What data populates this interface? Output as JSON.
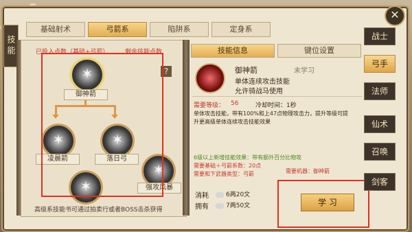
{
  "side_tab": "技能",
  "close_label": "✕",
  "top_tabs": [
    "基础射术",
    "弓箭系",
    "陷阱系",
    "定身系"
  ],
  "points": {
    "invested": "已投入点数（基础+弓箭）",
    "remaining": "剩余技能点数"
  },
  "help_label": "?",
  "tree": {
    "root": {
      "label": "御神箭",
      "glyph": "✶"
    },
    "left": {
      "label": "凌晨箭",
      "glyph": "✶"
    },
    "right": {
      "label": "落日弓",
      "glyph": "✶"
    },
    "bottom": {
      "label": "",
      "glyph": "✶"
    },
    "extra": {
      "label": "强攻风暴",
      "glyph": "✶"
    }
  },
  "hint": "高级系技能书可通过拍卖行或者BOSS击杀获得",
  "info_tabs": [
    "技能信息",
    "键位设置"
  ],
  "skill": {
    "name": "御神箭",
    "status": "未学习",
    "desc1": "单体连续攻击技能",
    "desc2": "允许骑战马使用",
    "req_level_label": "需要等级：",
    "req_level": "56",
    "cooldown": "冷却时间：1秒",
    "effect1": "单体攻击技能，带有100%和上47点物理攻击力，提升等级可提",
    "effect2": "升更高级单体连续攻击技能效果",
    "bonus1": "6级以上新增技能效果：带有额外百分比物攻",
    "bonus2": "需要基础＋弓箭系数：20点",
    "bonus3": "需要和下武器类型：弓箭",
    "req_weapon": "需要机器：御神箭",
    "cost_label": "消耗",
    "cost_value": "6两20文",
    "own_label": "拥有",
    "own_value": "7两50文"
  },
  "learn_button": "学 习",
  "classes": [
    "战士",
    "弓手",
    "法师",
    "仙术",
    "召唤",
    "剑客"
  ],
  "active_class": "弓手",
  "colors": {
    "accent": "#e3ae52",
    "highlight_red": "#e0301f",
    "text_red": "#c23a2e"
  }
}
